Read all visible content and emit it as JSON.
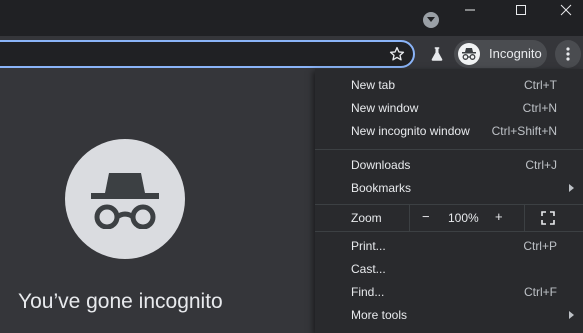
{
  "window": {
    "controls": [
      "minimize",
      "maximize",
      "close"
    ],
    "tab_search_icon": "chevron-down-circle-icon"
  },
  "toolbar": {
    "profile_label": "Incognito",
    "icons": [
      "star-icon",
      "flask-icon",
      "incognito-icon",
      "more-vert-icon"
    ]
  },
  "page": {
    "headline": "You’ve gone incognito"
  },
  "menu": {
    "group1": [
      {
        "label": "New tab",
        "shortcut": "Ctrl+T"
      },
      {
        "label": "New window",
        "shortcut": "Ctrl+N"
      },
      {
        "label": "New incognito window",
        "shortcut": "Ctrl+Shift+N"
      }
    ],
    "group2": [
      {
        "label": "Downloads",
        "shortcut": "Ctrl+J"
      },
      {
        "label": "Bookmarks",
        "shortcut": ""
      }
    ],
    "zoom": {
      "label": "Zoom",
      "minus": "−",
      "value": "100%",
      "plus": "+"
    },
    "group3": [
      {
        "label": "Print...",
        "shortcut": "Ctrl+P"
      },
      {
        "label": "Cast...",
        "shortcut": ""
      },
      {
        "label": "Find...",
        "shortcut": "Ctrl+F"
      },
      {
        "label": "More tools",
        "shortcut": ""
      }
    ]
  },
  "colors": {
    "frame": "#202124",
    "toolbar": "#35363a",
    "menu": "#292a2d",
    "accent": "#8ab4f8",
    "text": "#e8eaed"
  }
}
